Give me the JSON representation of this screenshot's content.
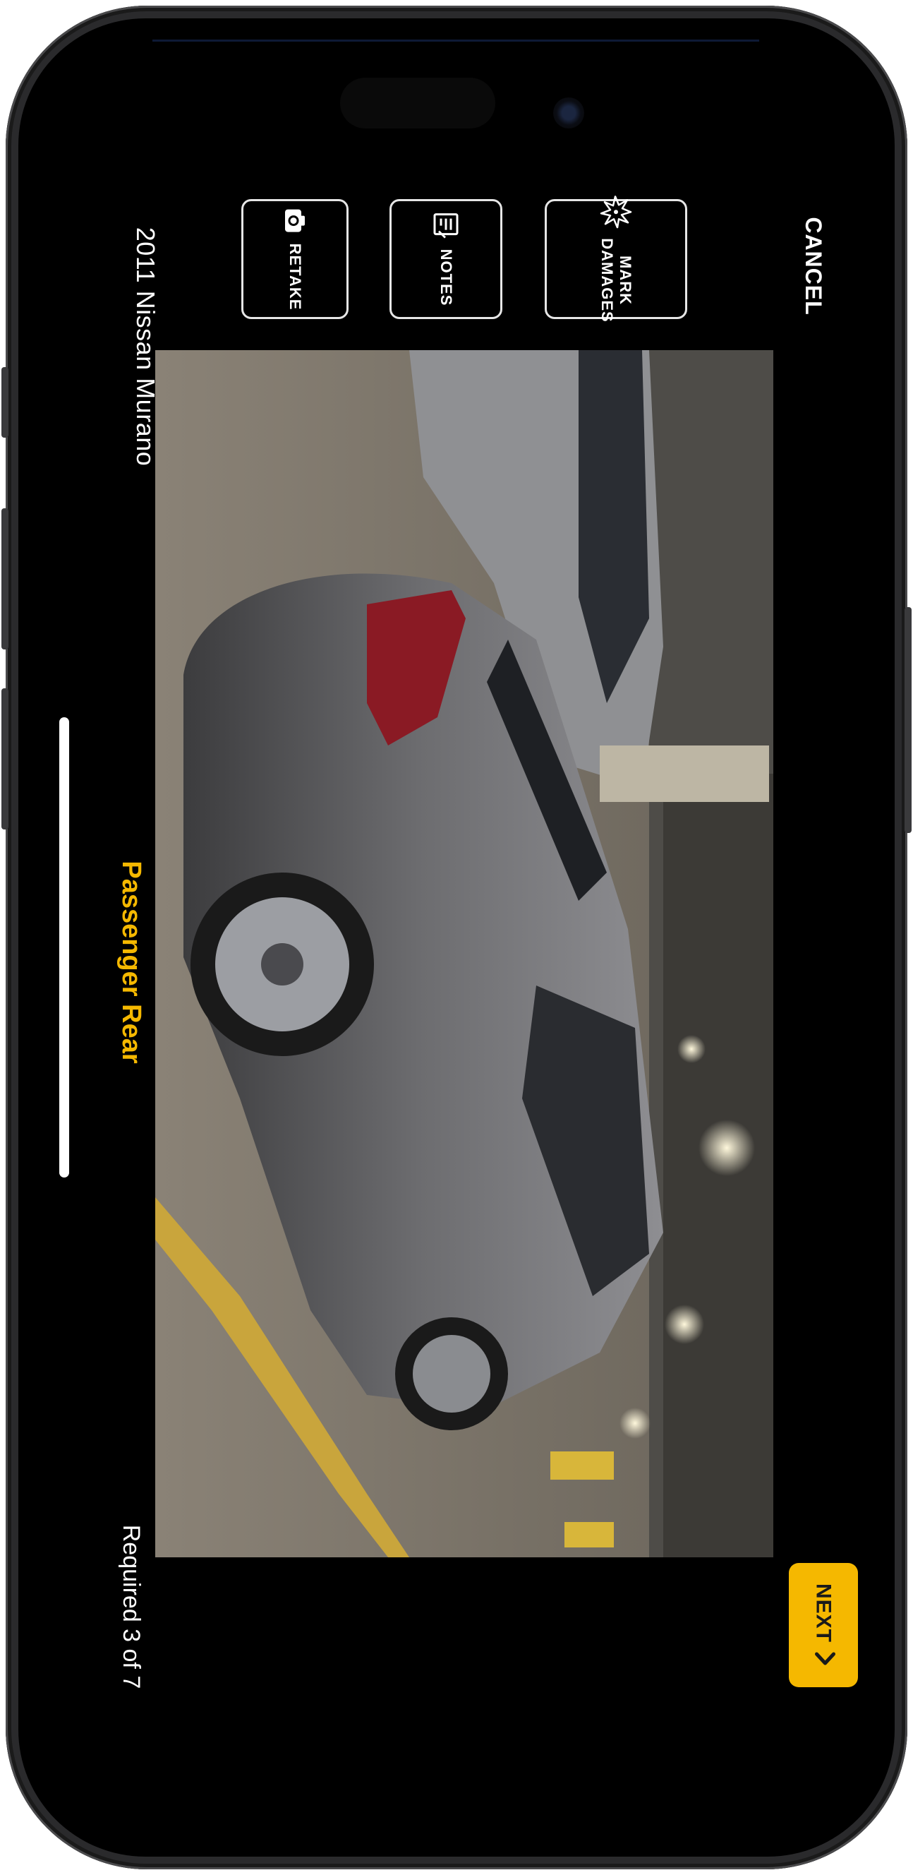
{
  "header": {
    "vehicle": "2011 Nissan Murano",
    "cancel_label": "CANCEL"
  },
  "capture": {
    "shot_label": "Passenger Rear",
    "progress": "Required 3 of 7"
  },
  "actions": [
    {
      "label": "RETAKE",
      "icon": "camera-icon"
    },
    {
      "label": "NOTES",
      "icon": "notes-icon"
    },
    {
      "label": "MARK\nDAMAGES",
      "icon": "damage-burst-icon"
    }
  ],
  "footer": {
    "next_label": "NEXT",
    "next_icon": "chevron-right-icon"
  },
  "colors": {
    "accent": "#f5b800",
    "background": "#000000",
    "text": "#ffffff"
  }
}
